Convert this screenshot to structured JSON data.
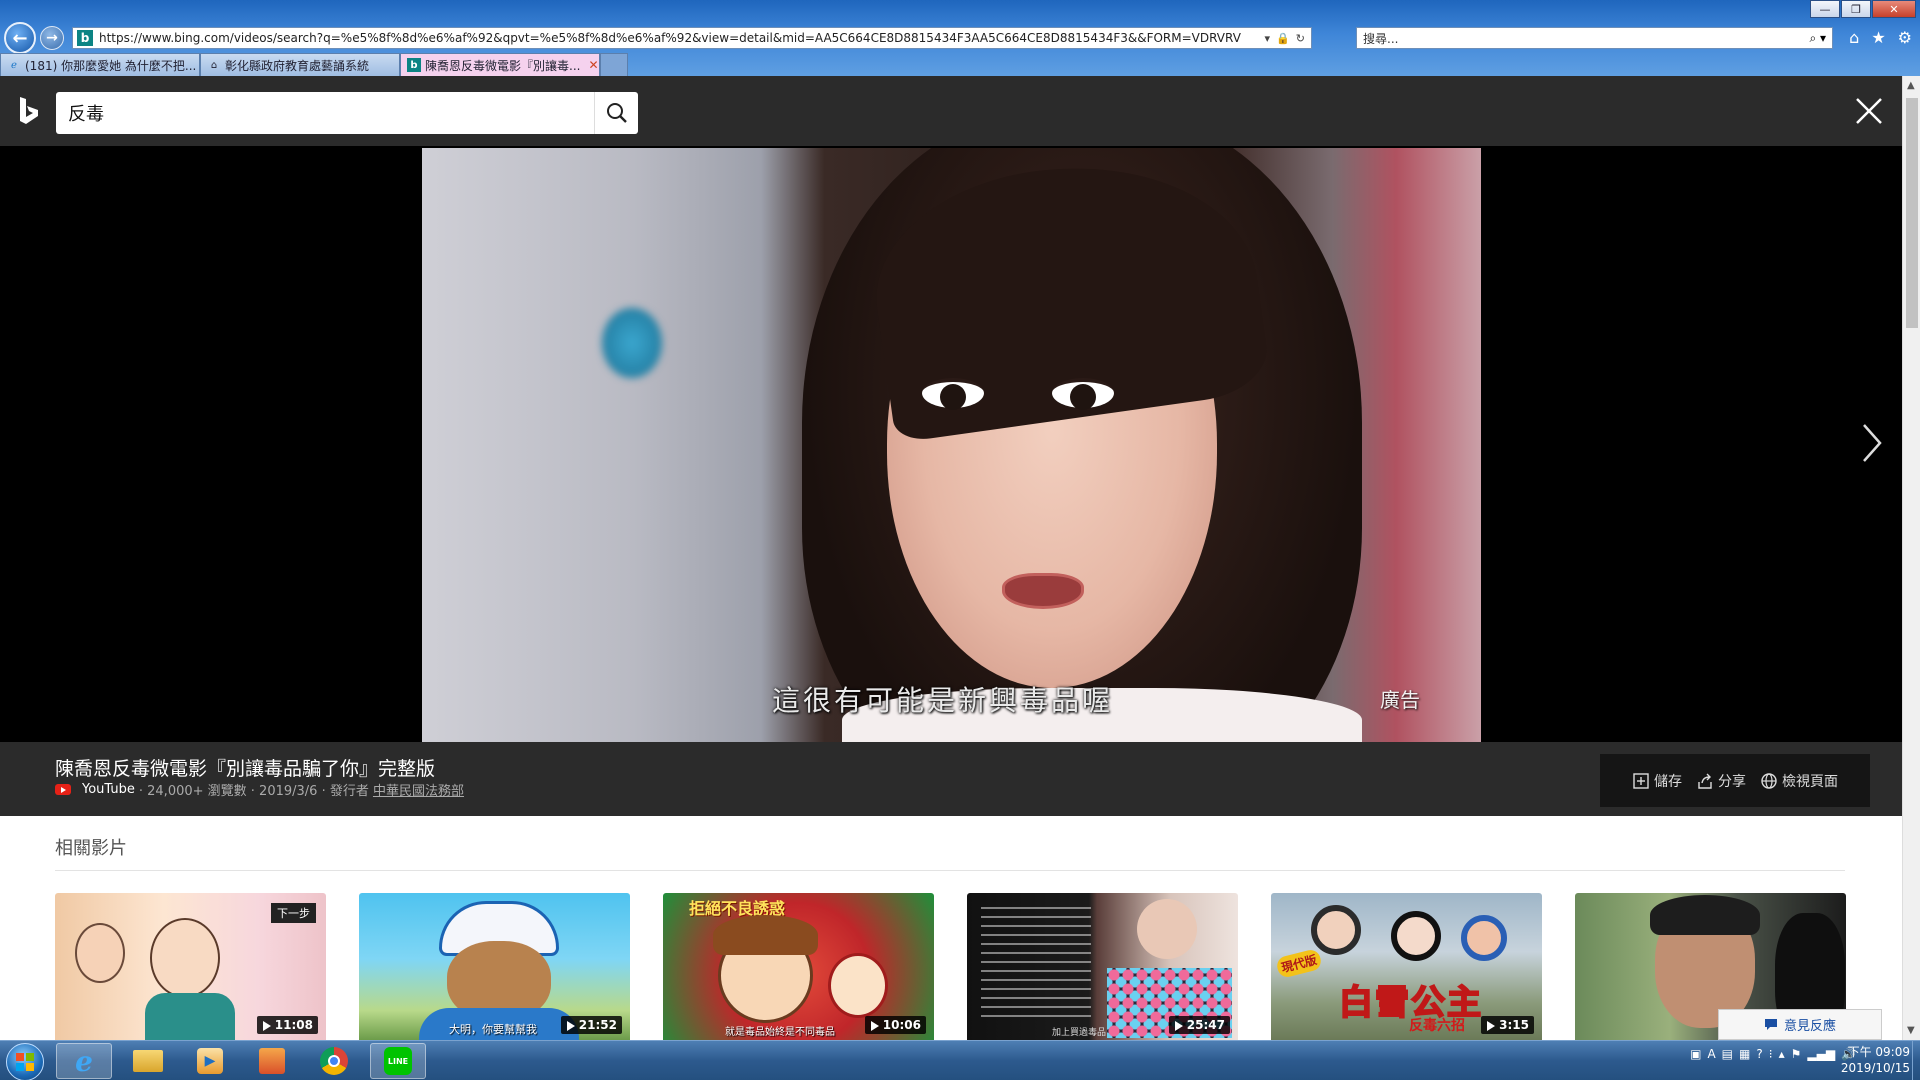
{
  "browser": {
    "address": "https://www.bing.com/videos/search?q=%e5%8f%8d%e6%af%92&qpvt=%e5%8f%8d%e6%af%92&view=detail&mid=AA5C664CE8D8815434F3AA5C664CE8D8815434F3&&FORM=VDRVRV",
    "search_placeholder": "搜尋...",
    "tabs": [
      {
        "label": "(181) 你那麼愛她 為什麼不把..."
      },
      {
        "label": "彰化縣政府教育處藝誦系統"
      },
      {
        "label": "陳喬恩反毒微電影『別讓毒..."
      }
    ]
  },
  "bing": {
    "query": "反毒"
  },
  "player": {
    "subtitle": "這很有可能是新興毒品喔",
    "ad_label": "廣告"
  },
  "video": {
    "title": "陳喬恩反毒微電影『別讓毒品騙了你』完整版",
    "source": "YouTube",
    "views": "· 24,000+ 瀏覽數 · 2019/3/6 · 發行者 ",
    "publisher": "中華民國法務部"
  },
  "actions": {
    "save": "儲存",
    "share": "分享",
    "view_page": "檢視頁面"
  },
  "related": {
    "heading": "相關影片",
    "items": [
      {
        "duration": "11:08",
        "tag": "下一步"
      },
      {
        "duration": "21:52",
        "caption": "大明，你要幫幫我"
      },
      {
        "duration": "10:06",
        "overlay": "拒絕不良誘惑",
        "caption": "就是毒品始終是不同毒品"
      },
      {
        "duration": "25:47",
        "caption": "加上買過毒品"
      },
      {
        "duration": "3:15",
        "badge": "現代版",
        "overlay": "白雪公主",
        "sub_overlay": "反毒六招"
      },
      {
        "duration": ""
      }
    ],
    "feedback": "意見反應"
  },
  "taskbar": {
    "clock_time": "下午 09:09",
    "clock_date": "2019/10/15"
  }
}
